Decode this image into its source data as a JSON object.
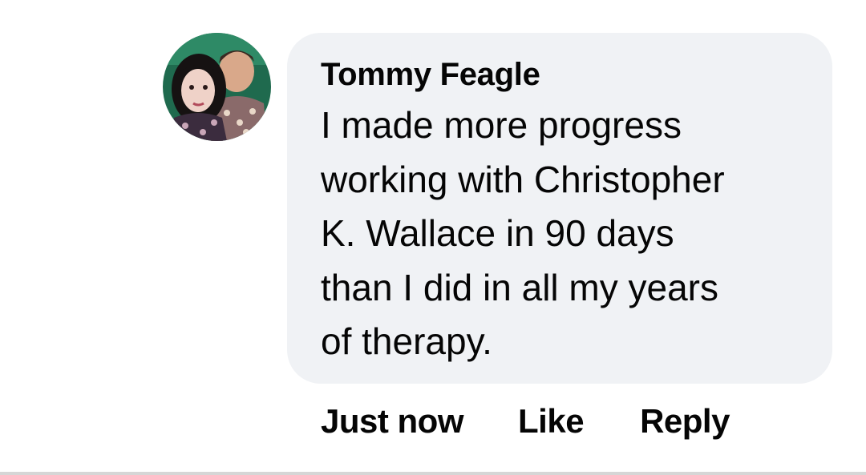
{
  "comment": {
    "author": "Tommy Feagle",
    "avatar_icon": "profile-photo-two-people",
    "text": "I made more progress\nworking with Christopher\nK. Wallace in 90 days\nthan I did in all my years\nof therapy."
  },
  "actions": {
    "timestamp": "Just now",
    "like_label": "Like",
    "reply_label": "Reply"
  },
  "colors": {
    "bubble_background": "#f0f2f5",
    "text": "#050505",
    "divider": "#d6d6d6"
  }
}
